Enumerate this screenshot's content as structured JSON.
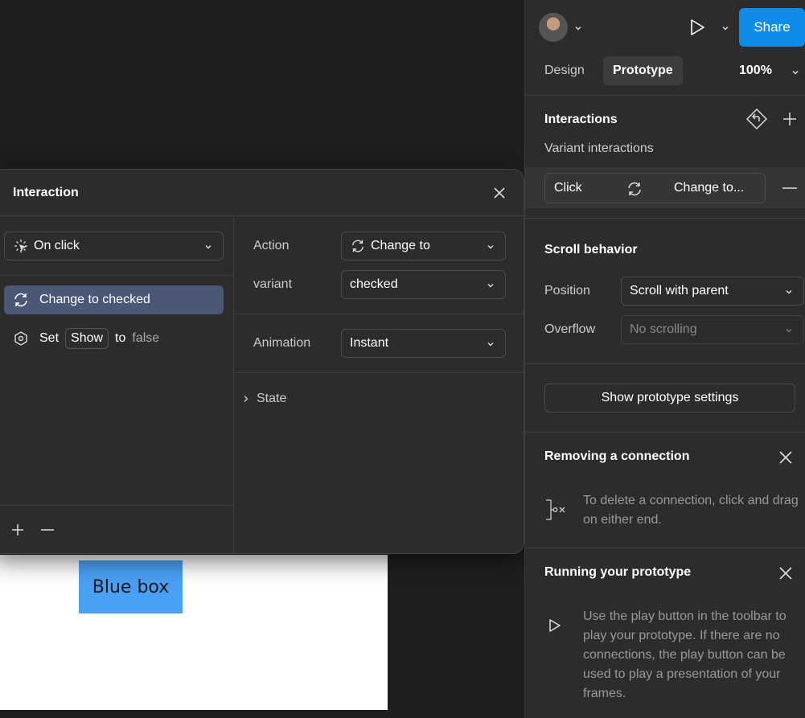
{
  "colors": {
    "share_bg": "#0d8ce8",
    "selected_action_bg": "#4b5777",
    "blue_box": "#4aa0f5"
  },
  "canvas": {
    "blue_box_label": "Blue box"
  },
  "modal": {
    "title": "Interaction",
    "trigger": {
      "icon": "click-icon",
      "value": "On click"
    },
    "actions": [
      {
        "icon": "swap-icon",
        "label": "Change to checked",
        "selected": true
      },
      {
        "icon": "set-variable-icon",
        "prefix": "Set",
        "chip": "Show",
        "middle": "to",
        "value": "false",
        "selected": false
      }
    ],
    "fields": {
      "action_label": "Action",
      "action_value": "Change to",
      "variant_label": "variant",
      "variant_value": "checked",
      "animation_label": "Animation",
      "animation_value": "Instant",
      "state_label": "State"
    }
  },
  "panel": {
    "share_label": "Share",
    "tabs": [
      {
        "label": "Design",
        "active": false
      },
      {
        "label": "Prototype",
        "active": true
      }
    ],
    "zoom": "100%",
    "interactions": {
      "heading": "Interactions",
      "subheading": "Variant interactions",
      "row": {
        "trigger": "Click",
        "action": "Change to..."
      }
    },
    "scroll_behavior": {
      "heading": "Scroll behavior",
      "position_label": "Position",
      "position_value": "Scroll with parent",
      "overflow_label": "Overflow",
      "overflow_value": "No scrolling"
    },
    "prototype_settings_button": "Show prototype settings",
    "removing_connection": {
      "heading": "Removing a connection",
      "text": "To delete a connection, click and drag on either end."
    },
    "running_prototype": {
      "heading": "Running your prototype",
      "text": "Use the play button in the toolbar to play your prototype. If there are no connections, the play button can be used to play a presentation of your frames."
    }
  }
}
